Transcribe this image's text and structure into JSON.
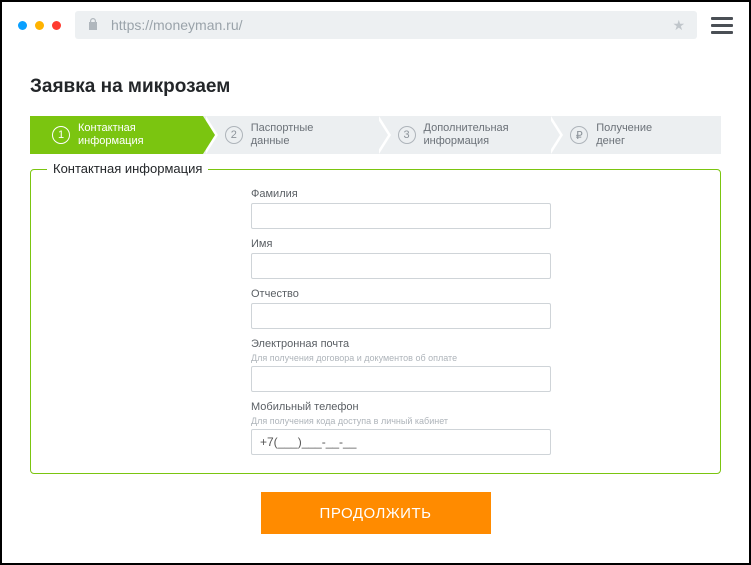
{
  "browser": {
    "url": "https://moneyman.ru/"
  },
  "page": {
    "title": "Заявка на микрозаем"
  },
  "steps": [
    {
      "num": "1",
      "label": "Контактная\nинформация",
      "active": true
    },
    {
      "num": "2",
      "label": "Паспортные\nданные",
      "active": false
    },
    {
      "num": "3",
      "label": "Дополнительная\nинформация",
      "active": false
    },
    {
      "num": "₽",
      "label": "Получение\nденег",
      "active": false
    }
  ],
  "form": {
    "legend": "Контактная информация",
    "fields": {
      "lastname": {
        "label": "Фамилия",
        "value": ""
      },
      "firstname": {
        "label": "Имя",
        "value": ""
      },
      "middlename": {
        "label": "Отчество",
        "value": ""
      },
      "email": {
        "label": "Электронная почта",
        "hint": "Для получения договора и документов об оплате",
        "value": ""
      },
      "phone": {
        "label": "Мобильный телефон",
        "hint": "Для получения кода доступа в личный кабинет",
        "value": "+7(___)___-__-__"
      }
    }
  },
  "submit": {
    "label": "ПРОДОЛЖИТЬ"
  }
}
